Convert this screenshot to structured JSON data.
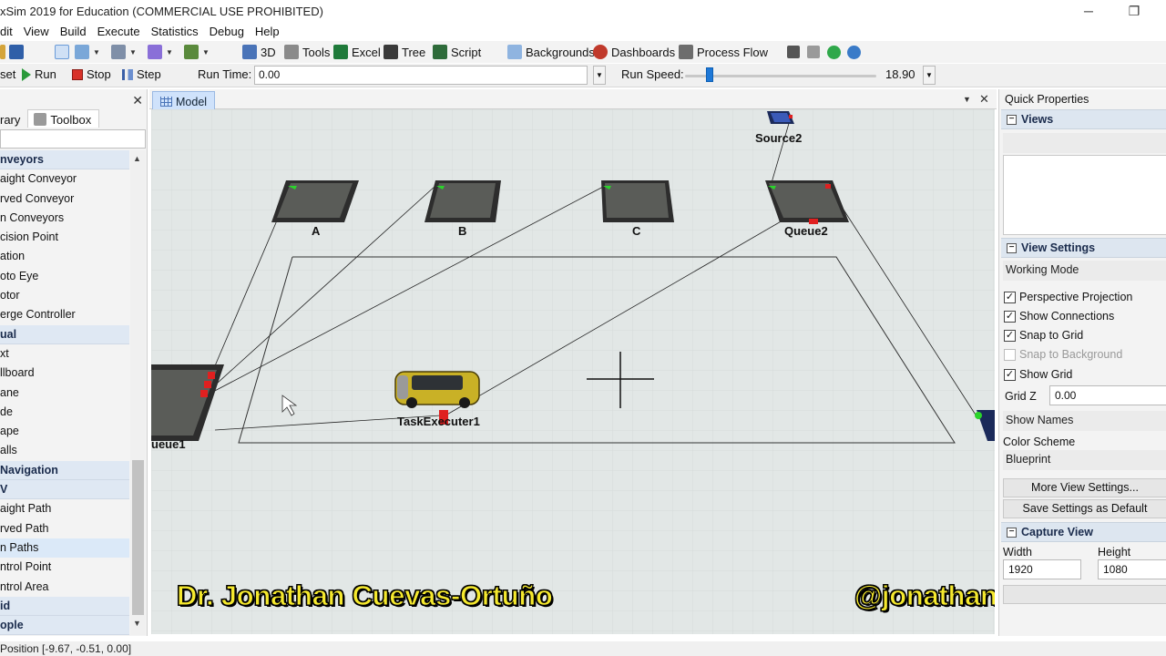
{
  "window": {
    "title": "xSim 2019 for Education (COMMERCIAL USE PROHIBITED)",
    "minimize": "─",
    "restore": "❐"
  },
  "menu": [
    "dit",
    "View",
    "Build",
    "Execute",
    "Statistics",
    "Debug",
    "Help"
  ],
  "toolbar": {
    "btn_3d": "3D",
    "tools": "Tools",
    "excel": "Excel",
    "tree": "Tree",
    "script": "Script",
    "backgrounds": "Backgrounds",
    "dashboards": "Dashboards",
    "process_flow": "Process Flow"
  },
  "runbar": {
    "reset": "set",
    "run": "Run",
    "stop": "Stop",
    "step": "Step",
    "run_time_label": "Run Time:",
    "run_time_value": "0.00",
    "run_speed_label": "Run Speed:",
    "run_speed_value": "18.90"
  },
  "library": {
    "tab_library": "rary",
    "tab_toolbox": "Toolbox",
    "items": [
      {
        "label": "nveyors",
        "type": "cat"
      },
      {
        "label": "aight Conveyor",
        "type": "item"
      },
      {
        "label": "rved Conveyor",
        "type": "item"
      },
      {
        "label": "n Conveyors",
        "type": "item"
      },
      {
        "label": "cision Point",
        "type": "item"
      },
      {
        "label": "ation",
        "type": "item"
      },
      {
        "label": "oto Eye",
        "type": "item"
      },
      {
        "label": "otor",
        "type": "item"
      },
      {
        "label": "erge Controller",
        "type": "item"
      },
      {
        "label": "ual",
        "type": "cat"
      },
      {
        "label": "xt",
        "type": "item"
      },
      {
        "label": "llboard",
        "type": "item"
      },
      {
        "label": "ane",
        "type": "item"
      },
      {
        "label": "de",
        "type": "item"
      },
      {
        "label": "ape",
        "type": "item"
      },
      {
        "label": "alls",
        "type": "item"
      },
      {
        "label": " Navigation",
        "type": "cat"
      },
      {
        "label": "V",
        "type": "cat"
      },
      {
        "label": "aight Path",
        "type": "item"
      },
      {
        "label": "rved Path",
        "type": "item"
      },
      {
        "label": "n Paths",
        "type": "hl"
      },
      {
        "label": "ntrol Point",
        "type": "item"
      },
      {
        "label": "ntrol Area",
        "type": "item"
      },
      {
        "label": "id",
        "type": "cat"
      },
      {
        "label": "ople",
        "type": "cat"
      }
    ]
  },
  "model": {
    "tab_label": "Model",
    "labels": {
      "a": "A",
      "b": "B",
      "c": "C",
      "queue2": "Queue2",
      "source2": "Source2",
      "queue1": "ueue1",
      "taskexecuter1": "TaskExecuter1"
    },
    "watermark_left": "Dr. Jonathan Cuevas-Ortuño",
    "watermark_right": "@jonathan_cuevas"
  },
  "quick_properties": {
    "title": "Quick Properties",
    "views_header": "Views",
    "view_settings_header": "View Settings",
    "working_mode": "Working Mode",
    "perspective_projection": "Perspective Projection",
    "show_connections": "Show Connections",
    "snap_to_grid": "Snap to Grid",
    "snap_to_background": "Snap to Background",
    "show_grid": "Show Grid",
    "grid_z_label": "Grid Z",
    "grid_z_value": "0.00",
    "show_names": "Show Names",
    "color_scheme_label": "Color Scheme",
    "color_scheme_value": "Blueprint",
    "more_view_settings": "More View Settings...",
    "save_settings_default": "Save Settings as Default",
    "capture_view_header": "Capture View",
    "width_label": "Width",
    "height_label": "Height",
    "width_value": "1920",
    "height_value": "1080",
    "checkmark": "✓",
    "collapse": "−"
  },
  "status": {
    "position": "Position [-9.67, -0.51, 0.00]"
  },
  "colors": {
    "accent": "#1e78d7",
    "watermark": "#f5e92e",
    "floor": "#dfe4e3",
    "category_bg": "#dfe8f3"
  }
}
